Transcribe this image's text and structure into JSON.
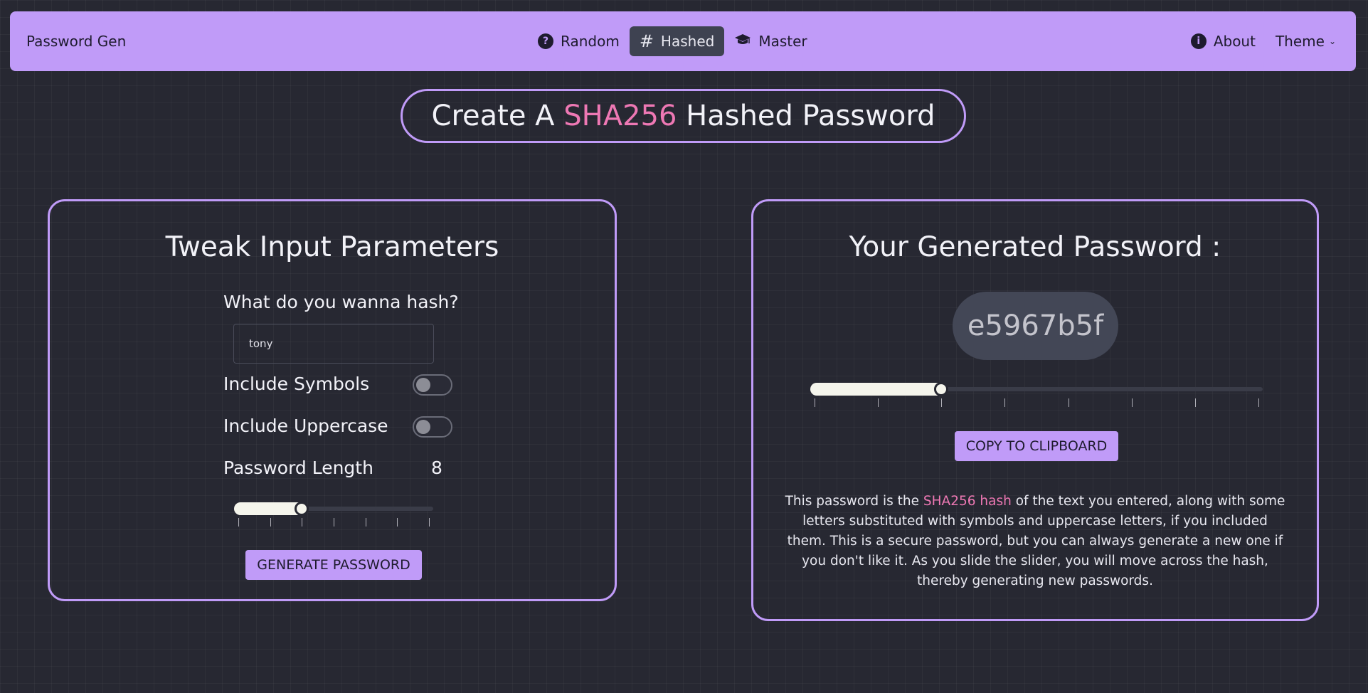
{
  "navbar": {
    "brand": "Password Gen",
    "items": [
      {
        "label": "Random",
        "icon": "question-circle-icon"
      },
      {
        "label": "Hashed",
        "icon": "hash-icon",
        "active": true
      },
      {
        "label": "Master",
        "icon": "graduation-cap-icon"
      }
    ],
    "about_label": "About",
    "theme_label": "Theme"
  },
  "page_title": {
    "prefix": "Create A ",
    "highlight": "SHA256",
    "suffix": " Hashed Password"
  },
  "input_card": {
    "title": "Tweak Input Parameters",
    "hash_label": "What do you wanna hash?",
    "hash_value": "tony",
    "symbols_label": "Include Symbols",
    "symbols_on": false,
    "uppercase_label": "Include Uppercase",
    "uppercase_on": false,
    "length_label": "Password Length",
    "length_value": "8",
    "length_slider": {
      "min": 0,
      "max": 6,
      "value": 2,
      "ticks": 7
    },
    "generate_label": "GENERATE PASSWORD"
  },
  "output_card": {
    "title": "Your Generated Password :",
    "password": "e5967b5f",
    "position_slider": {
      "min": 0,
      "max": 7,
      "value": 2,
      "ticks": 8
    },
    "copy_label": "COPY TO CLIPBOARD",
    "desc_prefix": "This password is the ",
    "desc_highlight": "SHA256 hash",
    "desc_suffix": " of the text you entered, along with some letters substituted with symbols and uppercase letters, if you included them. This is a secure password, but you can always generate a new one if you don't like it. As you slide the slider, you will move across the hash, thereby generating new passwords."
  },
  "colors": {
    "accent": "#c09bf8",
    "highlight": "#ee78b4",
    "background": "#272832"
  }
}
